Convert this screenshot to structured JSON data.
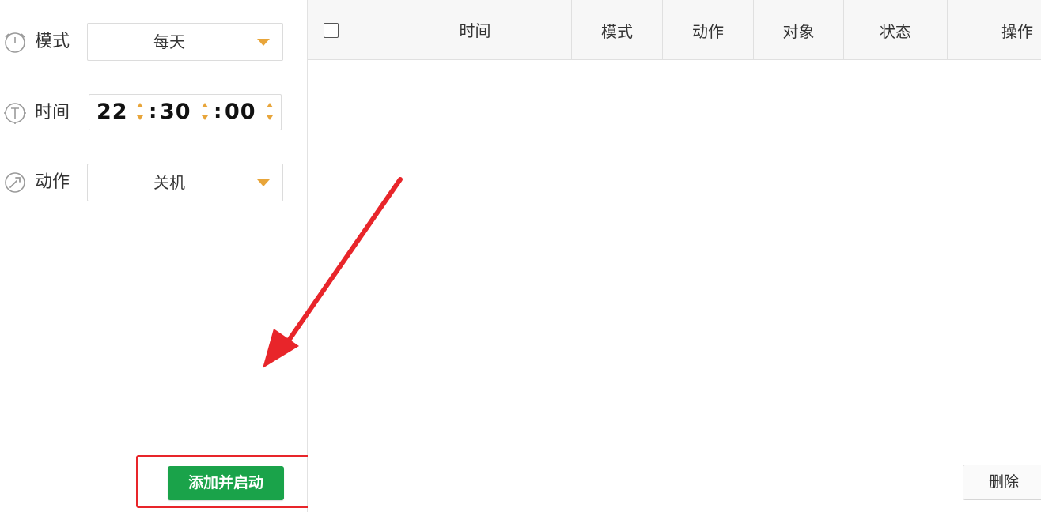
{
  "schedule_form": {
    "mode": {
      "label": "模式",
      "value": "每天",
      "icon": "clock-icon"
    },
    "time": {
      "label": "时间",
      "hour": "22",
      "minute": "30",
      "second": "00",
      "separator": ":",
      "icon": "timer-icon"
    },
    "action": {
      "label": "动作",
      "value": "关机",
      "icon": "wrench-icon"
    },
    "add_button_label": "添加并启动"
  },
  "task_table": {
    "columns": [
      "时间",
      "模式",
      "动作",
      "对象",
      "状态",
      "操作"
    ],
    "rows": [],
    "delete_button_label": "删除"
  },
  "colors": {
    "accent_orange": "#e8a53a",
    "primary_green": "#1aa34a",
    "highlight_red": "#e8252a"
  }
}
